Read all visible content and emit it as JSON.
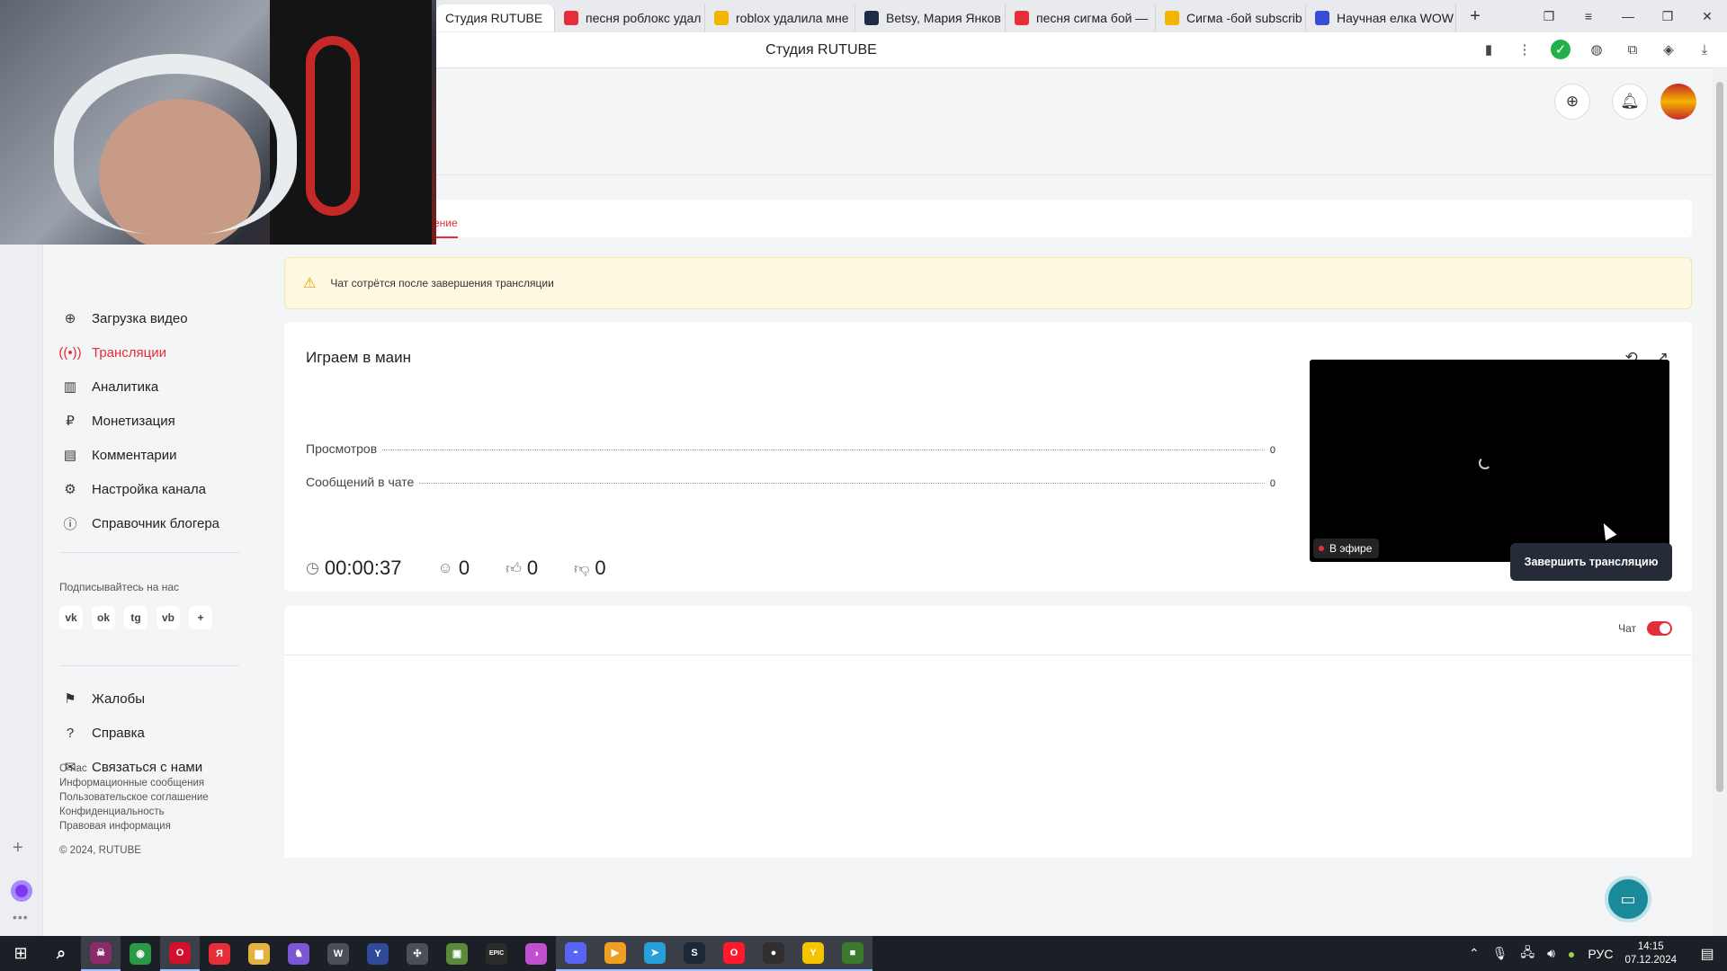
{
  "browser": {
    "tabs": [
      {
        "label": "Студия RUTUBE",
        "active": true,
        "favicon": "rutube-icon",
        "color": "#ffffff"
      },
      {
        "label": "песня роблокс удал",
        "favicon": "yandex-icon",
        "color": "#e52e3a"
      },
      {
        "label": "roblox удалила мне",
        "favicon": "youtube-icon",
        "color": "#f5b400"
      },
      {
        "label": "Betsy, Мария Янков",
        "favicon": "rutube-icon",
        "color": "#1f2a44"
      },
      {
        "label": "песня сигма бой —",
        "favicon": "yandex-icon",
        "color": "#e52e3a"
      },
      {
        "label": "Сигма -бой subscrib",
        "favicon": "youtube-icon",
        "color": "#f5b400"
      },
      {
        "label": "Научная елка WOW",
        "favicon": "site-icon",
        "color": "#3a4bd8"
      }
    ],
    "new_tab": "+",
    "page_title": "Студия RUTUBE"
  },
  "sidebar": {
    "items": [
      {
        "label": "Загрузка видео",
        "icon": "upload-icon",
        "glyph": "⊕"
      },
      {
        "label": "Трансляции",
        "icon": "broadcast-icon",
        "glyph": "((•))",
        "active": true
      },
      {
        "label": "Аналитика",
        "icon": "analytics-icon",
        "glyph": "▥"
      },
      {
        "label": "Монетизация",
        "icon": "ruble-icon",
        "glyph": "₽"
      },
      {
        "label": "Комментарии",
        "icon": "comments-icon",
        "glyph": "▤"
      },
      {
        "label": "Настройка канала",
        "icon": "gear-icon",
        "glyph": "⚙"
      },
      {
        "label": "Справочник блогера",
        "icon": "info-icon",
        "glyph": "ⓘ"
      }
    ],
    "follow_label": "Подписывайтесь на нас",
    "socials": [
      {
        "label": "vk",
        "icon": "vk-icon"
      },
      {
        "label": "ok",
        "icon": "odnoklassniki-icon"
      },
      {
        "label": "tg",
        "icon": "telegram-icon"
      },
      {
        "label": "vb",
        "icon": "viber-icon"
      },
      {
        "label": "+",
        "icon": "more-icon"
      }
    ],
    "secondary": [
      {
        "label": "Жалобы",
        "icon": "flag-icon",
        "glyph": "⚑"
      },
      {
        "label": "Справка",
        "icon": "help-icon",
        "glyph": "?"
      },
      {
        "label": "Связаться с нами",
        "icon": "mail-icon",
        "glyph": "✉"
      }
    ],
    "footer_links": [
      "О нас",
      "Информационные сообщения",
      "Пользовательское соглашение",
      "Конфиденциальность",
      "Правовая информация"
    ],
    "copyright": "© 2024, RUTUBE"
  },
  "content": {
    "tab_partial": "ение",
    "warning": "Чат сотрётся после завершения трансляции",
    "stream": {
      "title": "Играем в маин",
      "stats": [
        {
          "label": "Просмотров",
          "value": "0"
        },
        {
          "label": "Сообщений в чате",
          "value": "0"
        }
      ],
      "duration": "00:00:37",
      "viewers": "0",
      "likes": "0",
      "dislikes": "0",
      "live_label": "В эфире",
      "end_button": "Завершить трансляцию"
    },
    "chat_label": "Чат",
    "chat_enabled": true
  },
  "taskbar": {
    "apps": [
      {
        "icon": "game-app-icon",
        "glyph": "☠",
        "color": "#8b2c6a",
        "active": true
      },
      {
        "icon": "chrome-icon",
        "glyph": "◉",
        "color": "#2b9a44"
      },
      {
        "icon": "opera-gx-icon",
        "glyph": "O",
        "color": "#d0102f",
        "active": true
      },
      {
        "icon": "yandex-icon",
        "glyph": "Я",
        "color": "#e52e3a"
      },
      {
        "icon": "folder-icon",
        "glyph": "▆",
        "color": "#e3b341"
      },
      {
        "icon": "gamepad-icon",
        "glyph": "♞",
        "color": "#7b57d6"
      },
      {
        "icon": "tanks-icon",
        "glyph": "W",
        "color": "#4a4f58"
      },
      {
        "icon": "yandex-browser-icon",
        "glyph": "Y",
        "color": "#2f4a9a"
      },
      {
        "icon": "compass-icon",
        "glyph": "✣",
        "color": "#4a4f58"
      },
      {
        "icon": "minecraft-icon",
        "glyph": "▣",
        "color": "#5a8a3a"
      },
      {
        "icon": "epic-games-icon",
        "glyph": "EPIC",
        "color": "#2b2b2b"
      },
      {
        "icon": "color-wheel-icon",
        "glyph": "◑",
        "color": "#c04fd0"
      },
      {
        "icon": "discord-icon",
        "glyph": "◓",
        "color": "#5865f2",
        "active": true
      },
      {
        "icon": "play-icon",
        "glyph": "▶",
        "color": "#f0a020",
        "active": true
      },
      {
        "icon": "telegram-icon",
        "glyph": "➤",
        "color": "#2aa0da",
        "active": true
      },
      {
        "icon": "steam-icon",
        "glyph": "S",
        "color": "#1b2838",
        "active": true
      },
      {
        "icon": "opera-icon",
        "glyph": "O",
        "color": "#ff1b2d",
        "active": true
      },
      {
        "icon": "obs-icon",
        "glyph": "●",
        "color": "#302e31",
        "active": true
      },
      {
        "icon": "yandex-browser-alt-icon",
        "glyph": "Y",
        "color": "#f5c400",
        "active": true
      },
      {
        "icon": "minecraft-launcher-icon",
        "glyph": "■",
        "color": "#3b7a2c",
        "active": true
      }
    ],
    "lang": "РУС",
    "time": "14:15",
    "date": "07.12.2024"
  }
}
